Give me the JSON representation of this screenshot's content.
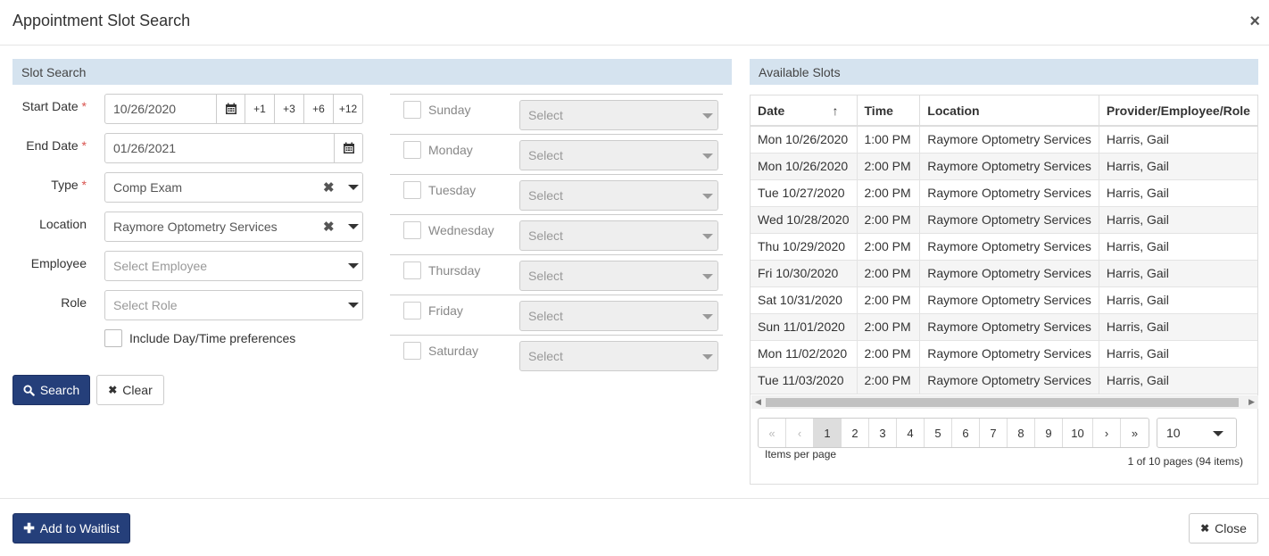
{
  "modal": {
    "title": "Appointment Slot Search",
    "close_icon": "×"
  },
  "slot_search": {
    "heading": "Slot Search",
    "start_date": {
      "label": "Start Date",
      "required": "*",
      "value": "10/26/2020",
      "offsets": [
        "+1",
        "+3",
        "+6",
        "+12"
      ]
    },
    "end_date": {
      "label": "End Date",
      "required": "*",
      "value": "01/26/2021"
    },
    "type": {
      "label": "Type",
      "required": "*",
      "value": "Comp Exam"
    },
    "location": {
      "label": "Location",
      "value": "Raymore Optometry Services"
    },
    "employee": {
      "label": "Employee",
      "placeholder": "Select Employee"
    },
    "role": {
      "label": "Role",
      "placeholder": "Select Role"
    },
    "include_prefs": "Include Day/Time preferences",
    "days": [
      {
        "name": "Sunday",
        "select": "Select"
      },
      {
        "name": "Monday",
        "select": "Select"
      },
      {
        "name": "Tuesday",
        "select": "Select"
      },
      {
        "name": "Wednesday",
        "select": "Select"
      },
      {
        "name": "Thursday",
        "select": "Select"
      },
      {
        "name": "Friday",
        "select": "Select"
      },
      {
        "name": "Saturday",
        "select": "Select"
      }
    ],
    "search_button": "Search",
    "clear_button": "Clear"
  },
  "available_slots": {
    "heading": "Available Slots",
    "columns": [
      "Date",
      "Time",
      "Location",
      "Provider/Employee/Role"
    ],
    "sort_indicator": "↑",
    "rows": [
      [
        "Mon 10/26/2020",
        "1:00 PM",
        "Raymore Optometry Services",
        "Harris, Gail"
      ],
      [
        "Mon 10/26/2020",
        "2:00 PM",
        "Raymore Optometry Services",
        "Harris, Gail"
      ],
      [
        "Tue 10/27/2020",
        "2:00 PM",
        "Raymore Optometry Services",
        "Harris, Gail"
      ],
      [
        "Wed 10/28/2020",
        "2:00 PM",
        "Raymore Optometry Services",
        "Harris, Gail"
      ],
      [
        "Thu 10/29/2020",
        "2:00 PM",
        "Raymore Optometry Services",
        "Harris, Gail"
      ],
      [
        "Fri 10/30/2020",
        "2:00 PM",
        "Raymore Optometry Services",
        "Harris, Gail"
      ],
      [
        "Sat 10/31/2020",
        "2:00 PM",
        "Raymore Optometry Services",
        "Harris, Gail"
      ],
      [
        "Sun 11/01/2020",
        "2:00 PM",
        "Raymore Optometry Services",
        "Harris, Gail"
      ],
      [
        "Mon 11/02/2020",
        "2:00 PM",
        "Raymore Optometry Services",
        "Harris, Gail"
      ],
      [
        "Tue 11/03/2020",
        "2:00 PM",
        "Raymore Optometry Services",
        "Harris, Gail"
      ]
    ],
    "pager": {
      "first": "«",
      "prev": "‹",
      "next": "›",
      "last": "»",
      "pages": [
        "1",
        "2",
        "3",
        "4",
        "5",
        "6",
        "7",
        "8",
        "9",
        "10"
      ],
      "current_page": "1",
      "page_size": "10",
      "items_per_page_label": "Items per page",
      "info": "1 of 10 pages (94 items)"
    }
  },
  "footer": {
    "add_waitlist": "Add to Waitlist",
    "close": "Close"
  }
}
